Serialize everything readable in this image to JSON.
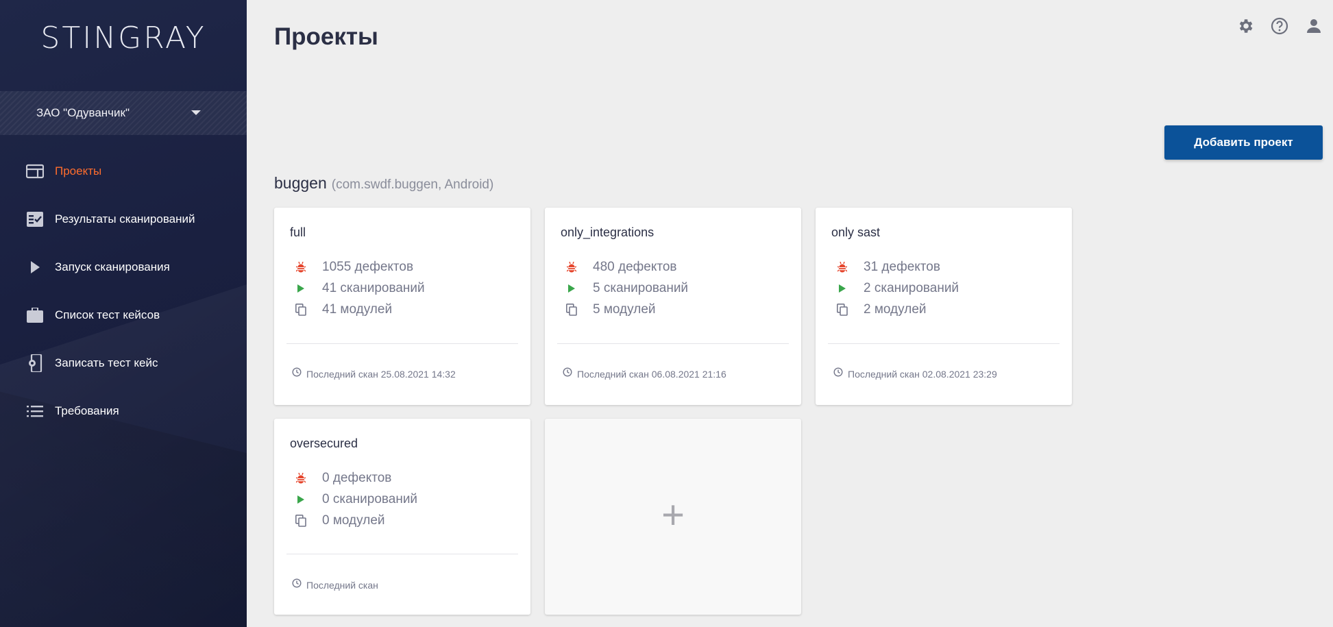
{
  "sidebar": {
    "logo": "STINGRAY",
    "org": "ЗАО \"Одуванчик\"",
    "items": [
      {
        "label": "Проекты",
        "icon": "projects-icon"
      },
      {
        "label": "Результаты сканирований",
        "icon": "scan-results-icon"
      },
      {
        "label": "Запуск сканирования",
        "icon": "play-icon"
      },
      {
        "label": "Список тест кейсов",
        "icon": "briefcase-icon"
      },
      {
        "label": "Записать тест кейс",
        "icon": "phone-gear-icon"
      },
      {
        "label": "Требования",
        "icon": "list-icon"
      }
    ]
  },
  "header": {
    "title": "Проекты",
    "icons": [
      "settings-icon",
      "help-icon",
      "account-icon"
    ]
  },
  "toolbar": {
    "add_project_label": "Добавить проект"
  },
  "project": {
    "name": "buggen",
    "meta": "(com.swdf.buggen, Android)",
    "cards": [
      {
        "title": "full",
        "defects": "1055 дефектов",
        "scans": "41 сканирований",
        "modules": "41 модулей",
        "last_scan": "Последний скан 25.08.2021 14:32"
      },
      {
        "title": "only_integrations",
        "defects": "480 дефектов",
        "scans": "5 сканирований",
        "modules": "5 модулей",
        "last_scan": "Последний скан 06.08.2021 21:16"
      },
      {
        "title": "only sast",
        "defects": "31 дефектов",
        "scans": "2 сканирований",
        "modules": "2 модулей",
        "last_scan": "Последний скан 02.08.2021 23:29"
      },
      {
        "title": "oversecured",
        "defects": "0 дефектов",
        "scans": "0 сканирований",
        "modules": "0 модулей",
        "last_scan": "Последний скан"
      }
    ],
    "add_card_symbol": "+"
  },
  "colors": {
    "accent": "#ff6d2d",
    "primary_button": "#0b5299",
    "defect_icon": "#e5452c",
    "scan_icon": "#3aa64b",
    "sidebar_bg": "#1c2342"
  }
}
